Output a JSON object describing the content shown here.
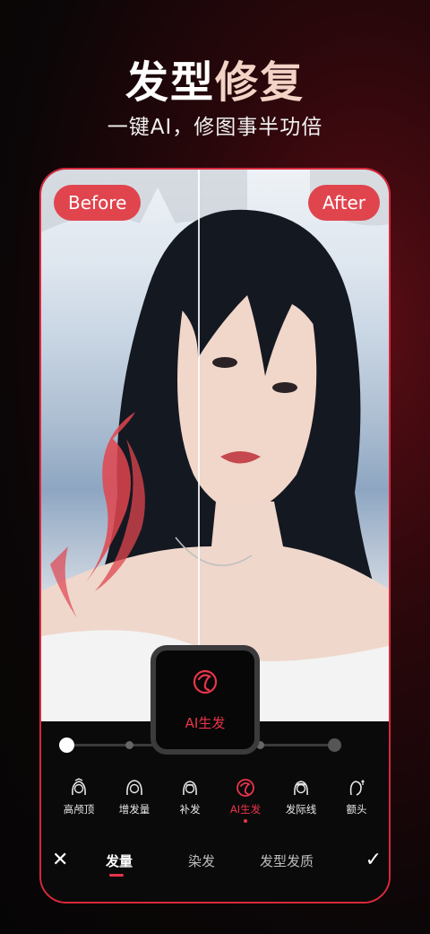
{
  "headline": {
    "part1": "发型",
    "part2": "修复"
  },
  "subtitle": "一键AI，修图事半功倍",
  "compare": {
    "before_label": "Before",
    "after_label": "After"
  },
  "popup": {
    "label": "AI生发",
    "icon": "ai-hair-icon"
  },
  "slider": {
    "value": 0.0
  },
  "tools": [
    {
      "label": "高颅顶",
      "icon": "high-crown-icon"
    },
    {
      "label": "增发量",
      "icon": "hair-volume-icon"
    },
    {
      "label": "补发",
      "icon": "hair-fill-icon"
    },
    {
      "label": "AI生发",
      "icon": "ai-hair-icon",
      "active": true
    },
    {
      "label": "发际线",
      "icon": "hairline-icon"
    },
    {
      "label": "额头",
      "icon": "forehead-icon"
    }
  ],
  "tabs": [
    {
      "label": "发量",
      "active": true
    },
    {
      "label": "染发"
    },
    {
      "label": "发型发质"
    }
  ],
  "colors": {
    "accent": "#e8354a",
    "pill": "#e0454e",
    "background": "#0b0607"
  }
}
